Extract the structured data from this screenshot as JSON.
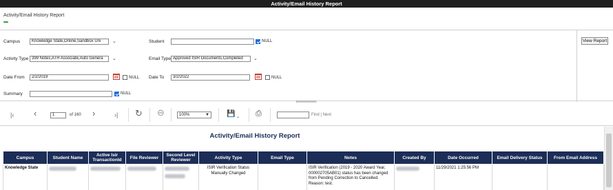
{
  "window": {
    "title": "Activity/Email History Report"
  },
  "page": {
    "heading": "Activity/Email History Report",
    "accent_color": "#3a9b3a"
  },
  "params": {
    "campus": {
      "label": "Campus",
      "value": "Knowledge State,Online,Sandbox Uni"
    },
    "student": {
      "label": "Student",
      "value": "",
      "null_label": "NULL",
      "null_checked": true
    },
    "activity_type": {
      "label": "Activity Type",
      "value": "399 Notes,ATH Associate,Auto Genera"
    },
    "email_type": {
      "label": "Email Type",
      "value": "Approved ISIR Documents,Completed"
    },
    "date_from": {
      "label": "Date From",
      "value": "2/2/2019",
      "null_label": "NULL",
      "null_checked": false
    },
    "date_to": {
      "label": "Date To",
      "value": "3/2/2022",
      "null_label": "NULL",
      "null_checked": false
    },
    "summary": {
      "label": "Summary",
      "value": "",
      "null_label": "NULL",
      "null_checked": true
    },
    "view_report_label": "View Report"
  },
  "toolbar": {
    "page_number": "1",
    "page_of": "of 160",
    "zoom": "100%",
    "find_label": "Find",
    "next_label": "Next",
    "separator": "|"
  },
  "report": {
    "title": "Activity/Email History Report",
    "header_color": "#1c2d57",
    "columns": [
      "Campus",
      "Student Name",
      "Active Isir TransactionId",
      "File Reviewer",
      "Second Level Reviewer",
      "Activity Type",
      "Email Type",
      "Notes",
      "Created By",
      "Date Occurred",
      "Email Delivery Status",
      "From Email Address"
    ],
    "rows": [
      {
        "campus": "Knowledge State",
        "activity_type": "ISIR Verification Status Manually Changed",
        "email_type": "",
        "notes": "ISIR Verification (2019 - 2020 Award Year, 000002705AB01) status has been changed from Pending Correction to Cancelled. Reason: test.",
        "date_occurred": "11/29/2021 1:25:56 PM",
        "email_delivery_status": "",
        "from_email_address": ""
      }
    ]
  }
}
